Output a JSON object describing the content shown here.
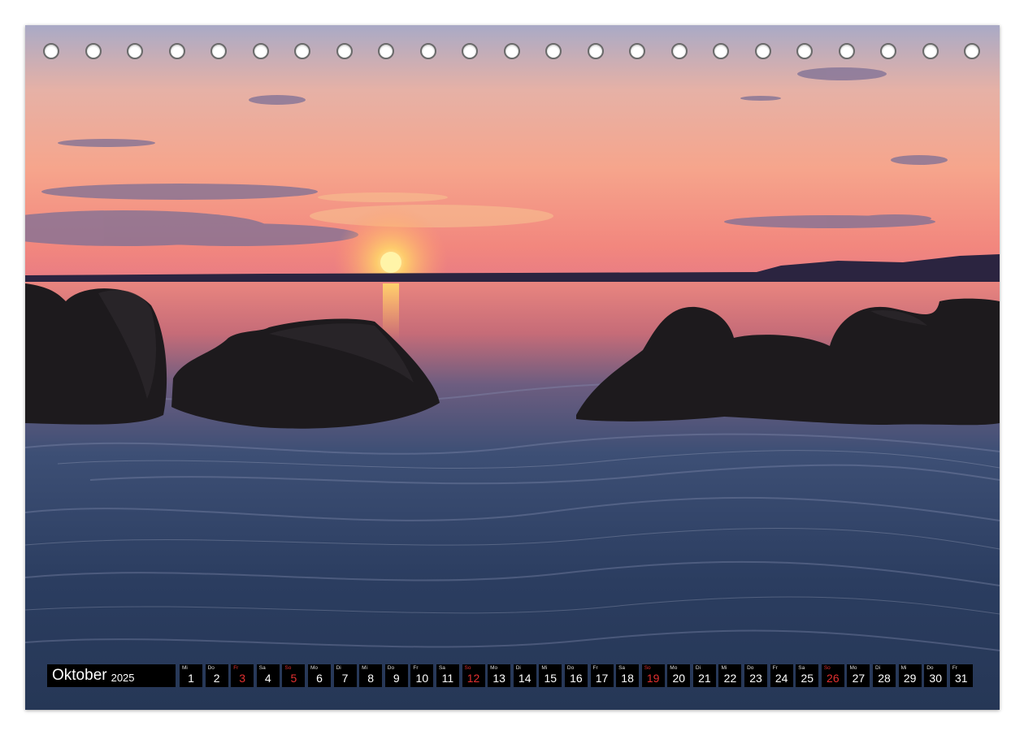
{
  "calendar": {
    "month": "Oktober",
    "year": "2025",
    "days": [
      {
        "wd": "Mi",
        "n": "1",
        "we": false
      },
      {
        "wd": "Do",
        "n": "2",
        "we": false
      },
      {
        "wd": "Fr",
        "n": "3",
        "we": true
      },
      {
        "wd": "Sa",
        "n": "4",
        "we": false
      },
      {
        "wd": "So",
        "n": "5",
        "we": true
      },
      {
        "wd": "Mo",
        "n": "6",
        "we": false
      },
      {
        "wd": "Di",
        "n": "7",
        "we": false
      },
      {
        "wd": "Mi",
        "n": "8",
        "we": false
      },
      {
        "wd": "Do",
        "n": "9",
        "we": false
      },
      {
        "wd": "Fr",
        "n": "10",
        "we": false
      },
      {
        "wd": "Sa",
        "n": "11",
        "we": false
      },
      {
        "wd": "So",
        "n": "12",
        "we": true
      },
      {
        "wd": "Mo",
        "n": "13",
        "we": false
      },
      {
        "wd": "Di",
        "n": "14",
        "we": false
      },
      {
        "wd": "Mi",
        "n": "15",
        "we": false
      },
      {
        "wd": "Do",
        "n": "16",
        "we": false
      },
      {
        "wd": "Fr",
        "n": "17",
        "we": false
      },
      {
        "wd": "Sa",
        "n": "18",
        "we": false
      },
      {
        "wd": "So",
        "n": "19",
        "we": true
      },
      {
        "wd": "Mo",
        "n": "20",
        "we": false
      },
      {
        "wd": "Di",
        "n": "21",
        "we": false
      },
      {
        "wd": "Mi",
        "n": "22",
        "we": false
      },
      {
        "wd": "Do",
        "n": "23",
        "we": false
      },
      {
        "wd": "Fr",
        "n": "24",
        "we": false
      },
      {
        "wd": "Sa",
        "n": "25",
        "we": false
      },
      {
        "wd": "So",
        "n": "26",
        "we": true
      },
      {
        "wd": "Mo",
        "n": "27",
        "we": false
      },
      {
        "wd": "Di",
        "n": "28",
        "we": false
      },
      {
        "wd": "Mi",
        "n": "29",
        "we": false
      },
      {
        "wd": "Do",
        "n": "30",
        "we": false
      },
      {
        "wd": "Fr",
        "n": "31",
        "we": false
      }
    ]
  },
  "binding": {
    "hole_count": 23
  },
  "colors": {
    "sky_top": "#a7a9c4",
    "sky_mid": "#f2a98d",
    "sky_horizon": "#f38a80",
    "sun": "#ffe27a",
    "water_far": "#e8837e",
    "water_near": "#2a3c5e",
    "rocks": "#1d1a1d",
    "weekend": "#e33030"
  }
}
